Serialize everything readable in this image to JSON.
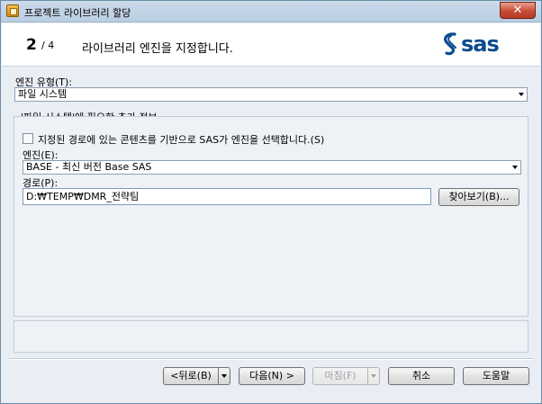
{
  "window": {
    "title": "프로젝트 라이브러리 할당",
    "close_symbol": "✕"
  },
  "header": {
    "step_current": "2",
    "step_total": "/ 4",
    "title": "라이브러리 엔진을 지정합니다.",
    "logo_text": "sas"
  },
  "engine_type": {
    "label": "엔진 유형(T):",
    "value": "파일 시스템"
  },
  "group": {
    "title": "'파일 시스템'에 필요한 추가 정보",
    "checkbox_label": "지정된 경로에 있는 콘텐츠를 기반으로 SAS가 엔진을 선택합니다.(S)",
    "checkbox_checked": false,
    "engine_label": "엔진(E):",
    "engine_value": "BASE - 최신 버전 Base SAS",
    "path_label": "경로(P):",
    "path_value": "D:₩TEMP₩DMR_전략팀",
    "browse_button": "찾아보기(B)..."
  },
  "footer": {
    "back_button": "<뒤로(B)",
    "next_button": "다음(N) >",
    "finish_button": "마침(F)",
    "cancel_button": "취소",
    "help_button": "도움말"
  },
  "colors": {
    "accent": "#0b4c8f",
    "title_bar": "#cddbea",
    "close_button": "#c74b34"
  }
}
